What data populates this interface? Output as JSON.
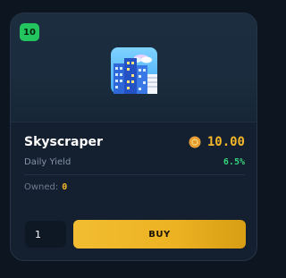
{
  "card": {
    "level_badge": "10",
    "icon": "skyscraper-icon",
    "name": "Skyscraper",
    "price": {
      "icon": "coin-icon",
      "value": "10.00"
    },
    "yield": {
      "label": "Daily Yield",
      "value": "6.5%"
    },
    "owned": {
      "label": "Owned:",
      "value": "0"
    },
    "quantity": {
      "value": "1"
    },
    "buy_label": "BUY"
  },
  "colors": {
    "accent_gold": "#f5b729",
    "yield_green": "#34d27b",
    "badge_green": "#22c55e",
    "card_bg": "#14202f"
  }
}
